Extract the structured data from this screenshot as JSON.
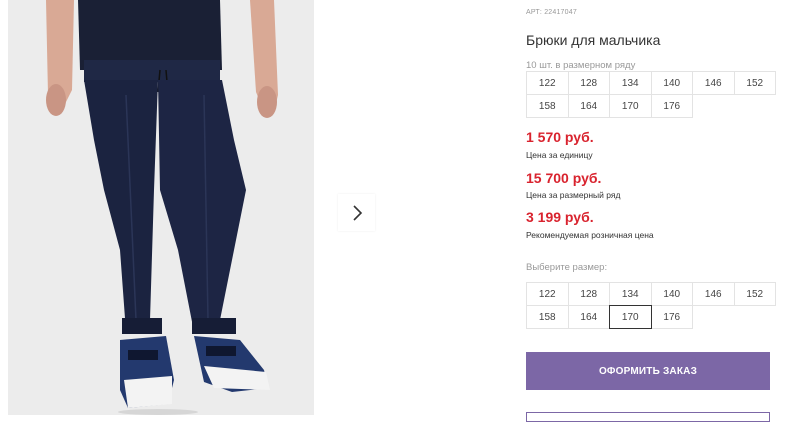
{
  "product": {
    "article": "АРТ: 22417047",
    "title": "Брюки для мальчика"
  },
  "pack": {
    "caption": "10 шт. в размерном ряду",
    "sizes": [
      "122",
      "128",
      "134",
      "140",
      "146",
      "152",
      "158",
      "164",
      "170",
      "176"
    ]
  },
  "prices": {
    "unit_price": "1 570 руб.",
    "unit_label": "Цена за единицу",
    "row_price": "15 700 руб.",
    "row_label": "Цена за размерный ряд",
    "retail_price": "3 199 руб.",
    "retail_label": "Рекомендуемая розничная цена"
  },
  "size_select": {
    "caption": "Выберите размер:",
    "sizes": [
      "122",
      "128",
      "134",
      "140",
      "146",
      "152",
      "158",
      "164",
      "170",
      "176"
    ],
    "selected": "170"
  },
  "actions": {
    "order_label": "ОФОРМИТЬ ЗАКАЗ"
  },
  "gallery": {
    "next_icon": "chevron-right-icon"
  },
  "colors": {
    "price": "#d9232e",
    "accent": "#7c67a6",
    "pants": "#1b2340"
  }
}
